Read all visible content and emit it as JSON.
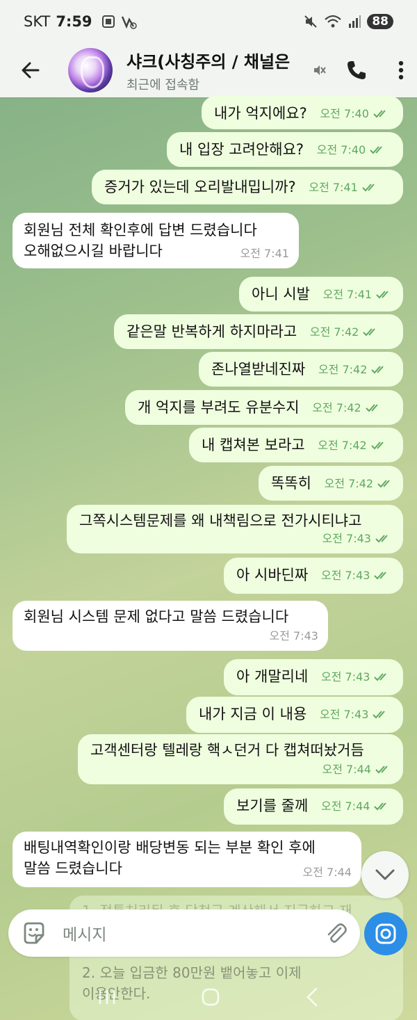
{
  "status": {
    "carrier": "SKT",
    "time": "7:59",
    "battery": "88"
  },
  "header": {
    "title": "샤크(사칭주의 / 채널은",
    "subtitle": "최근에 접속함"
  },
  "messages": [
    {
      "text": "내가 억지에요?",
      "time": "오전 7:40"
    },
    {
      "text": "내 입장 고려안해요?",
      "time": "오전 7:40"
    },
    {
      "text": "증거가 있는데 오리발내밉니까?",
      "time": "오전 7:41"
    },
    {
      "text1": "회원님 전체 확인후에 답변 드렸습니다",
      "text2": "오해없으시길 바랍니다",
      "time": "오전 7:41"
    },
    {
      "text": "아니 시발",
      "time": "오전 7:41"
    },
    {
      "text": "같은말 반복하게 하지마라고",
      "time": "오전 7:42"
    },
    {
      "text": "존나열받네진짜",
      "time": "오전 7:42"
    },
    {
      "text": "개 억지를 부려도 유분수지",
      "time": "오전 7:42"
    },
    {
      "text": "내 캡쳐본 보라고",
      "time": "오전 7:42"
    },
    {
      "text": "똑똑히",
      "time": "오전 7:42"
    },
    {
      "text": "그쪽시스템문제를 왜 내책림으로 전가시티냐고",
      "time": "오전 7:43"
    },
    {
      "text": "아 시바딘짜",
      "time": "오전 7:43"
    },
    {
      "text": "회원님 시스템 문제 없다고 말씀 드렸습니다",
      "time": "오전 7:43"
    },
    {
      "text": "아 개말리네",
      "time": "오전 7:43"
    },
    {
      "text": "내가 지금 이 내용",
      "time": "오전 7:43"
    },
    {
      "text": "고객센터랑 텔레랑 핵ㅅ던거 다 캡쳐떠놨거듬",
      "time": "오전 7:44"
    },
    {
      "text": "보기를 줄께",
      "time": "오전 7:44"
    },
    {
      "text1": "배팅내역확인이랑 배당변동 되는 부분 확인 후에",
      "text2": "말씀 드렸습니다",
      "time": "오전 7:44"
    }
  ],
  "partial_message": {
    "line1": "1. 적특처리된 후 당첨금 계산해서 지급하고 재",
    "line2": "2. 오늘 입금한 80만원 뱉어놓고 이제",
    "line3": "이용안한다."
  },
  "input": {
    "placeholder": "메시지"
  },
  "colors": {
    "outgoing_bubble": "#effedf",
    "incoming_bubble": "#ffffff",
    "accent": "#2c8ee6",
    "check_green": "#5fa861"
  }
}
